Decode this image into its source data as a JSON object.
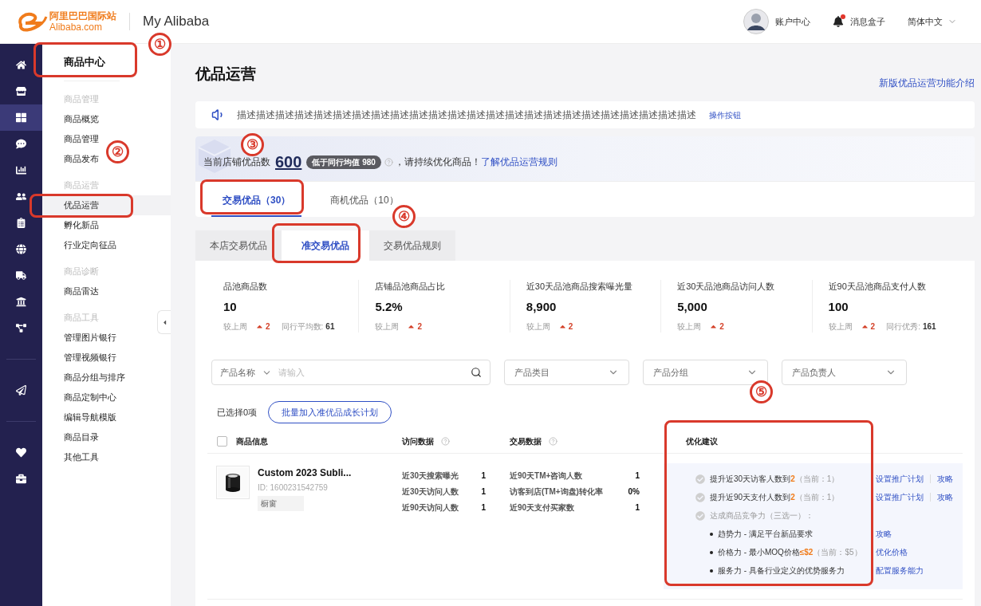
{
  "header": {
    "logo_cn": "阿里巴巴国际站",
    "logo_en": "Alibaba.com",
    "title": "My Alibaba",
    "account": "账户中心",
    "messages": "消息盒子",
    "messages_unread": true,
    "language": "简体中文"
  },
  "rail": [
    [
      {
        "selected": false
      },
      {
        "selected": false
      },
      {
        "selected": true
      },
      {
        "selected": false
      },
      {
        "selected": false
      },
      {
        "selected": false
      },
      {
        "selected": false
      },
      {
        "selected": false
      },
      {
        "selected": false
      },
      {
        "selected": false
      },
      {
        "selected": false
      }
    ],
    [
      {
        "selected": false
      }
    ],
    [
      {
        "selected": false
      },
      {
        "selected": false
      }
    ]
  ],
  "sidebar": {
    "title": "商品中心",
    "groups": [
      {
        "heading": "商品管理",
        "items": [
          {
            "label": "商品概览",
            "selected": false
          },
          {
            "label": "商品管理",
            "selected": false
          },
          {
            "label": "商品发布",
            "selected": false
          }
        ]
      },
      {
        "heading": "商品运营",
        "items": [
          {
            "label": "优品运营",
            "selected": true
          },
          {
            "label": "孵化新品",
            "selected": false
          },
          {
            "label": "行业定向征品",
            "selected": false
          }
        ]
      },
      {
        "heading": "商品诊断",
        "items": [
          {
            "label": "商品雷达",
            "selected": false
          }
        ]
      },
      {
        "heading": "商品工具",
        "items": [
          {
            "label": "管理图片银行",
            "selected": false
          },
          {
            "label": "管理视频银行",
            "selected": false
          },
          {
            "label": "商品分组与排序",
            "selected": false
          },
          {
            "label": "商品定制中心",
            "selected": false
          },
          {
            "label": "编辑导航模版",
            "selected": false
          },
          {
            "label": "商品目录",
            "selected": false
          },
          {
            "label": "其他工具",
            "selected": false
          }
        ]
      }
    ]
  },
  "page": {
    "title": "优品运营",
    "intro_link": "新版优品运营功能介绍"
  },
  "notice": {
    "text": "描述描述描述描述描述描述描述描述描述描述描述描述描述描述描述描述描述描述描述描述描述描述描述描述",
    "action": "操作按钮"
  },
  "summary": {
    "label": "当前店铺优品数",
    "count": "600",
    "badge": "低于同行均值 980",
    "message": "，请持续优化商品！",
    "link": "了解优品运营规则"
  },
  "tabs": [
    {
      "label": "交易优品（30）",
      "selected": true
    },
    {
      "label": "商机优品（10）",
      "selected": false
    }
  ],
  "subtabs": [
    {
      "label": "本店交易优品",
      "selected": false
    },
    {
      "label": "准交易优品",
      "selected": true
    },
    {
      "label": "交易优品规则",
      "selected": false
    }
  ],
  "stats": [
    {
      "label": "品池商品数",
      "value": "10",
      "change_label": "较上周",
      "change": "2",
      "change_up": true,
      "peer_label": "同行平均数:",
      "peer_value": "61"
    },
    {
      "label": "店铺品池商品占比",
      "value": "5.2%",
      "change_label": "较上周",
      "change": "2",
      "change_up": true
    },
    {
      "label": "近30天品池商品搜索曝光量",
      "value": "8,900",
      "change_label": "较上周",
      "change": "2",
      "change_up": true
    },
    {
      "label": "近30天品池商品访问人数",
      "value": "5,000",
      "change_label": "较上周",
      "change": "2",
      "change_up": true
    },
    {
      "label": "近90天品池商品支付人数",
      "value": "100",
      "change_label": "较上周",
      "change": "2",
      "change_up": true,
      "peer_label": "同行优秀:",
      "peer_value": "161"
    }
  ],
  "filters": {
    "search_type": "产品名称",
    "placeholder": "请输入",
    "dropdowns": [
      "产品类目",
      "产品分组",
      "产品负责人"
    ]
  },
  "selection": {
    "count_text": "已选择0项",
    "batch_button": "批量加入准优品成长计划"
  },
  "table": {
    "select_all": {
      "checked": false
    },
    "columns": [
      {
        "label": "商品信息",
        "help": false
      },
      {
        "label": "访问数据",
        "help": true
      },
      {
        "label": "交易数据",
        "help": true
      },
      {
        "label": "优化建议",
        "help": false
      }
    ],
    "rows": [
      {
        "product": {
          "title": "Custom 2023 Subli...",
          "id": "ID: 1600231542759",
          "tag": "橱窗"
        },
        "visits": [
          {
            "label": "近30天搜索曝光",
            "value": "1"
          },
          {
            "label": "近30天访问人数",
            "value": "1"
          },
          {
            "label": "近90天访问人数",
            "value": "1"
          }
        ],
        "trades": [
          {
            "label": "近90天TM+咨询人数",
            "value": "1"
          },
          {
            "label": "访客到店(TM+询盘)转化率",
            "value": "0%"
          },
          {
            "label": "近90天支付买家数",
            "value": "1"
          }
        ],
        "suggestions": [
          {
            "kind": "check",
            "text": "提升近30天访客人数到",
            "target": "2",
            "current": "（当前：1）",
            "actions": [
              "设置推广计划",
              "攻略"
            ]
          },
          {
            "kind": "check",
            "text": "提升近90天支付人数到",
            "target": "2",
            "current": "（当前：1）",
            "actions": [
              "设置推广计划",
              "攻略"
            ]
          },
          {
            "kind": "heading",
            "text": "达成商品竞争力（三选一）："
          },
          {
            "kind": "bullet",
            "text": "趋势力 - 满足平台新品要求",
            "actions": [
              "攻略"
            ]
          },
          {
            "kind": "bullet",
            "text": "价格力 - 最小MOQ价格",
            "target": "≤$2",
            "current": "（当前：$5）",
            "actions": [
              "优化价格"
            ]
          },
          {
            "kind": "bullet",
            "text": "服务力 - 具备行业定义的优势服务力",
            "actions": [
              "配置服务能力"
            ]
          }
        ]
      }
    ]
  },
  "annotations": [
    "①",
    "②",
    "③",
    "④",
    "⑤"
  ]
}
